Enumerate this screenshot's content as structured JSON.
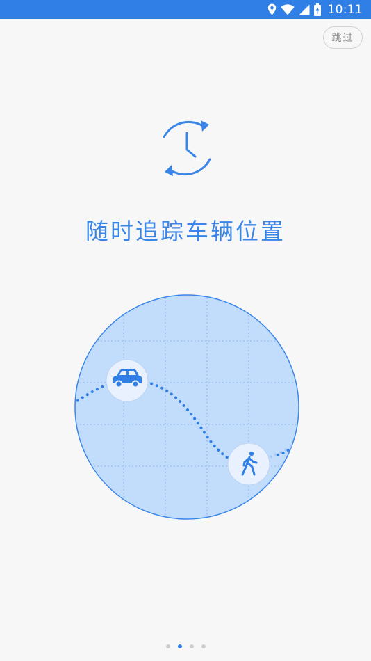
{
  "status_bar": {
    "time": "10:11",
    "icons": [
      "location-icon",
      "wifi-icon",
      "signal-icon",
      "battery-charging-icon"
    ]
  },
  "skip_button": {
    "label": "跳过"
  },
  "feature": {
    "icon": "clock-refresh-icon",
    "title": "随时追踪车辆位置",
    "illustration_icons": [
      "car-icon",
      "walking-person-icon"
    ]
  },
  "pager": {
    "total": 4,
    "active_index": 1
  },
  "colors": {
    "accent": "#2f7fe6",
    "title": "#3a86e8",
    "map_fill": "#c2dcfb",
    "background": "#f7f7f7"
  }
}
